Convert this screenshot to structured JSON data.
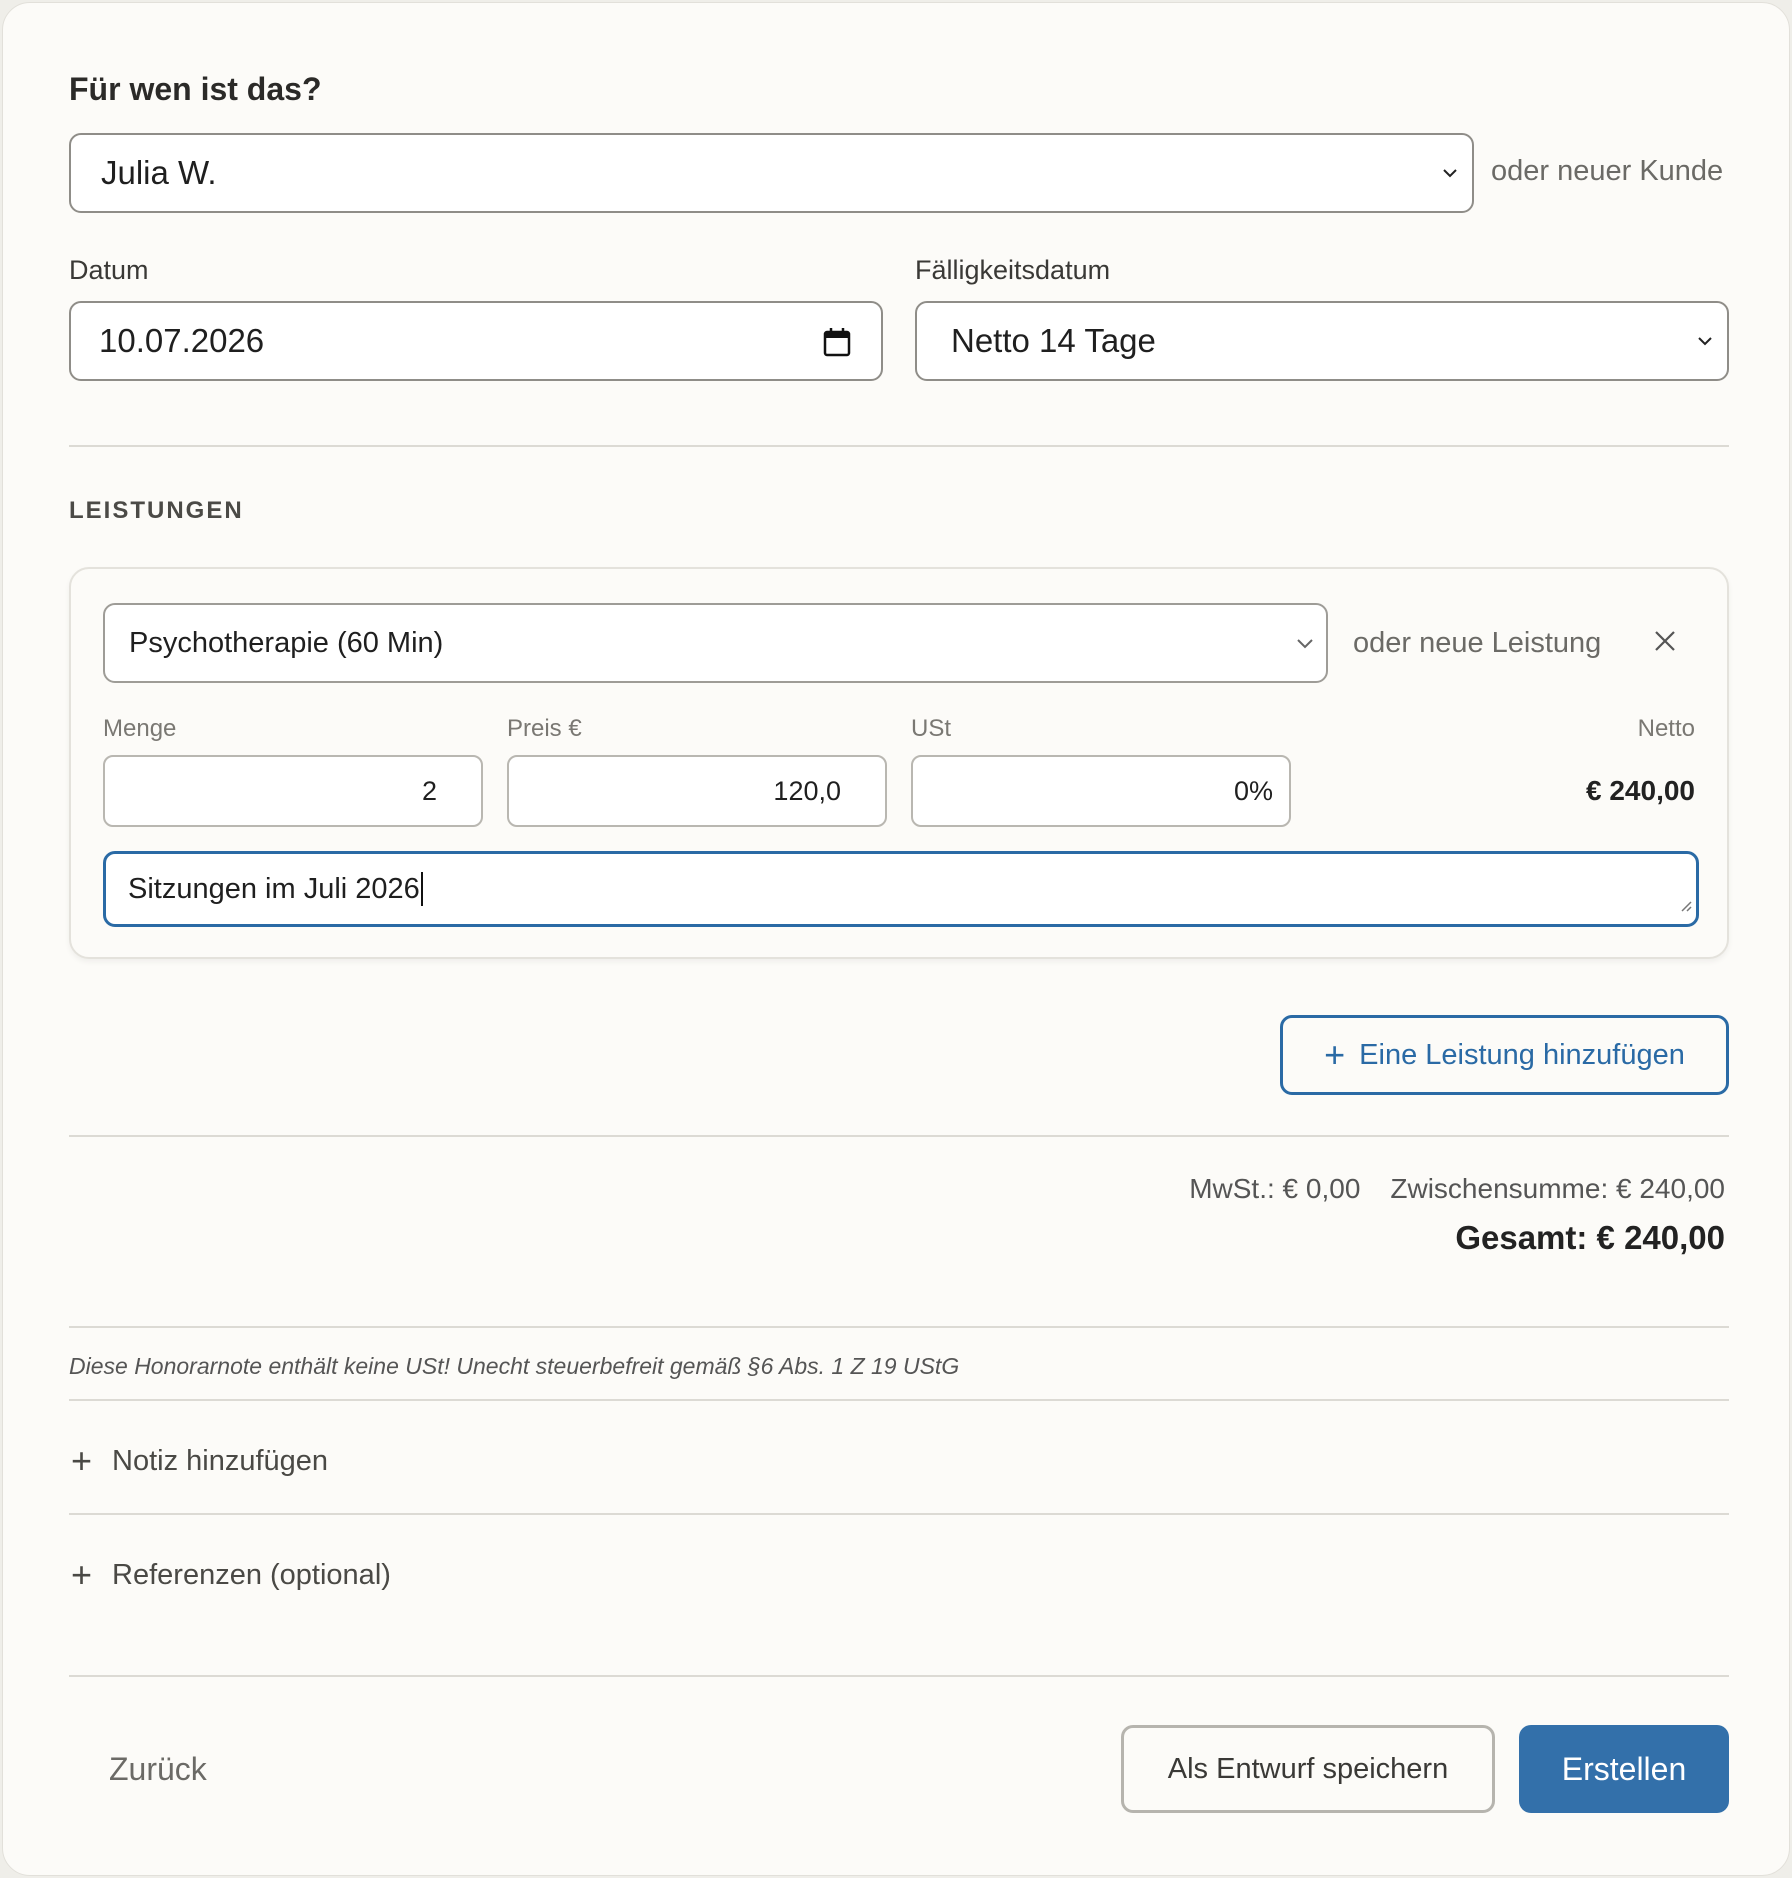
{
  "client": {
    "heading": "Für wen ist das?",
    "selected": "Julia W.",
    "new_link": "oder neuer Kunde"
  },
  "dates": {
    "date_label": "Datum",
    "date_value": "10.07.2026",
    "due_label": "Fälligkeitsdatum",
    "due_value": "Netto 14 Tage"
  },
  "services": {
    "section_title": "LEISTUNGEN",
    "item": {
      "service": "Psychotherapie (60 Min)",
      "new_link": "oder neue Leistung",
      "qty_label": "Menge",
      "qty_value": "2",
      "price_label": "Preis €",
      "price_value": "120,0",
      "vat_label": "USt",
      "vat_value": "0%",
      "net_label": "Netto",
      "net_value": "€ 240,00",
      "description": "Sitzungen im Juli 2026"
    },
    "add_button": "Eine Leistung hinzufügen"
  },
  "totals": {
    "vat": "MwSt.: € 0,00",
    "subtotal": "Zwischensumme: € 240,00",
    "total": "Gesamt: € 240,00"
  },
  "notice": "Diese Honorarnote enthält keine USt! Unecht steuerbefreit gemäß §6 Abs. 1 Z 19 UStG",
  "expanders": {
    "note": "Notiz hinzufügen",
    "references": "Referenzen (optional)"
  },
  "footer": {
    "back": "Zurück",
    "save_draft": "Als Entwurf speichern",
    "create": "Erstellen"
  },
  "colors": {
    "accent": "#3370aa",
    "focus_border": "#2a6aa5"
  },
  "icons": {
    "select_chevron": "chevron-down-icon",
    "date_picker": "calendar-icon",
    "remove": "close-icon",
    "add": "plus-icon"
  }
}
